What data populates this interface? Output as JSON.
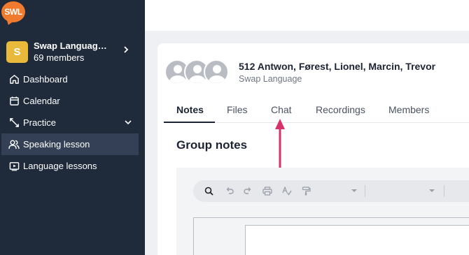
{
  "logo": {
    "text": "SWL"
  },
  "group": {
    "initial": "S",
    "name": "Swap Languag…",
    "members": "69 members"
  },
  "nav": {
    "items": [
      {
        "label": "Dashboard",
        "icon": "home-icon"
      },
      {
        "label": "Calendar",
        "icon": "calendar-icon"
      },
      {
        "label": "Practice",
        "icon": "practice-icon"
      },
      {
        "label": "Speaking lesson",
        "icon": "users-icon"
      },
      {
        "label": "Language lessons",
        "icon": "video-icon"
      }
    ],
    "active": "Speaking lesson"
  },
  "conversation": {
    "title": "512 Antwon, Førest, Lionel, Marcin, Trevor",
    "subtitle": "Swap Language"
  },
  "tabs": [
    {
      "label": "Notes"
    },
    {
      "label": "Files"
    },
    {
      "label": "Chat"
    },
    {
      "label": "Recordings"
    },
    {
      "label": "Members"
    }
  ],
  "active_tab": "Notes",
  "section": {
    "title": "Group notes"
  },
  "colors": {
    "sidebar": "#1f2a3b",
    "brand": "#f07a2e",
    "group_avatar": "#e8b93b",
    "arrow": "#d6336c"
  }
}
